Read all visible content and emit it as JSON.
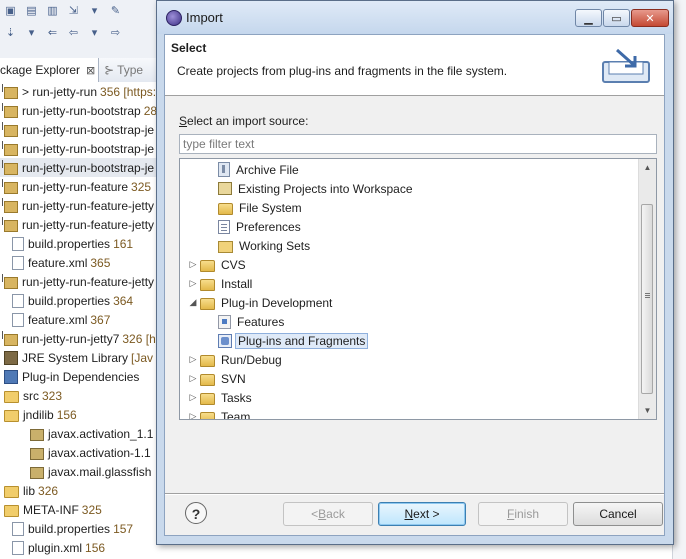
{
  "background": {
    "view_tab_label": "ckage Explorer",
    "view_tab_close": "⊠",
    "other_tab_label": "Type",
    "tree": [
      {
        "label": "> run-jetty-run",
        "extra": "356 [https:",
        "icon": "project"
      },
      {
        "label": "run-jetty-run-bootstrap",
        "extra": "28",
        "icon": "project"
      },
      {
        "label": "run-jetty-run-bootstrap-je",
        "extra": "",
        "icon": "project"
      },
      {
        "label": "run-jetty-run-bootstrap-je",
        "extra": "",
        "icon": "project"
      },
      {
        "label": "run-jetty-run-bootstrap-je",
        "extra": "",
        "icon": "project",
        "selected": true
      },
      {
        "label": "run-jetty-run-feature",
        "extra": "325",
        "icon": "project"
      },
      {
        "label": "run-jetty-run-feature-jetty",
        "extra": "",
        "icon": "project"
      },
      {
        "label": "run-jetty-run-feature-jetty",
        "extra": "",
        "icon": "project"
      },
      {
        "label": "build.properties",
        "extra": "161",
        "icon": "file"
      },
      {
        "label": "feature.xml",
        "extra": "365",
        "icon": "file"
      },
      {
        "label": "run-jetty-run-feature-jetty",
        "extra": "",
        "icon": "project"
      },
      {
        "label": "build.properties",
        "extra": "364",
        "icon": "file"
      },
      {
        "label": "feature.xml",
        "extra": "367",
        "icon": "file"
      },
      {
        "label": "run-jetty-run-jetty7",
        "extra": "326 [h",
        "icon": "project"
      },
      {
        "label": "JRE System Library",
        "extra": "[Jav",
        "icon": "library"
      },
      {
        "label": "Plug-in Dependencies",
        "extra": "",
        "icon": "plugin"
      },
      {
        "label": "src",
        "extra": "323",
        "icon": "folder"
      },
      {
        "label": "jndilib",
        "extra": "156",
        "icon": "folder"
      },
      {
        "label": "javax.activation_1.1",
        "extra": "",
        "icon": "jar"
      },
      {
        "label": "javax.activation-1.1",
        "extra": "",
        "icon": "jar"
      },
      {
        "label": "javax.mail.glassfish",
        "extra": "",
        "icon": "jar"
      },
      {
        "label": "lib",
        "extra": "326",
        "icon": "folder"
      },
      {
        "label": "META-INF",
        "extra": "325",
        "icon": "folder"
      },
      {
        "label": "build.properties",
        "extra": "157",
        "icon": "file"
      },
      {
        "label": "plugin.xml",
        "extra": "156",
        "icon": "file"
      }
    ]
  },
  "dialog": {
    "title": "Import",
    "banner": {
      "title": "Select",
      "description": "Create projects from plug-ins and fragments in the file system."
    },
    "source_label_prefix": "S",
    "source_label_rest": "elect an import source:",
    "filter": {
      "value": "",
      "placeholder": "type filter text"
    },
    "tree": [
      {
        "label": "Archive File",
        "level": 2,
        "expander": "",
        "icon": "archive"
      },
      {
        "label": "Existing Projects into Workspace",
        "level": 2,
        "expander": "",
        "icon": "projects"
      },
      {
        "label": "File System",
        "level": 2,
        "expander": "",
        "icon": "folder"
      },
      {
        "label": "Preferences",
        "level": 2,
        "expander": "",
        "icon": "prefs"
      },
      {
        "label": "Working Sets",
        "level": 2,
        "expander": "",
        "icon": "wsets"
      },
      {
        "label": "CVS",
        "level": 1,
        "expander": "▷",
        "icon": "folder"
      },
      {
        "label": "Install",
        "level": 1,
        "expander": "▷",
        "icon": "folder"
      },
      {
        "label": "Plug-in Development",
        "level": 1,
        "expander": "◢",
        "icon": "folder"
      },
      {
        "label": "Features",
        "level": 2,
        "expander": "",
        "icon": "feature"
      },
      {
        "label": "Plug-ins and Fragments",
        "level": 2,
        "expander": "",
        "icon": "plugin",
        "selected": true
      },
      {
        "label": "Run/Debug",
        "level": 1,
        "expander": "▷",
        "icon": "folder"
      },
      {
        "label": "SVN",
        "level": 1,
        "expander": "▷",
        "icon": "folder"
      },
      {
        "label": "Tasks",
        "level": 1,
        "expander": "▷",
        "icon": "folder"
      },
      {
        "label": "Team",
        "level": 1,
        "expander": "▷",
        "icon": "folder"
      }
    ],
    "buttons": {
      "help": "?",
      "back_arrow": "< ",
      "back_mnemonic": "B",
      "back_rest": "ack",
      "next_mnemonic": "N",
      "next_rest": "ext >",
      "finish_mnemonic": "F",
      "finish_rest": "inish",
      "cancel": "Cancel"
    }
  }
}
